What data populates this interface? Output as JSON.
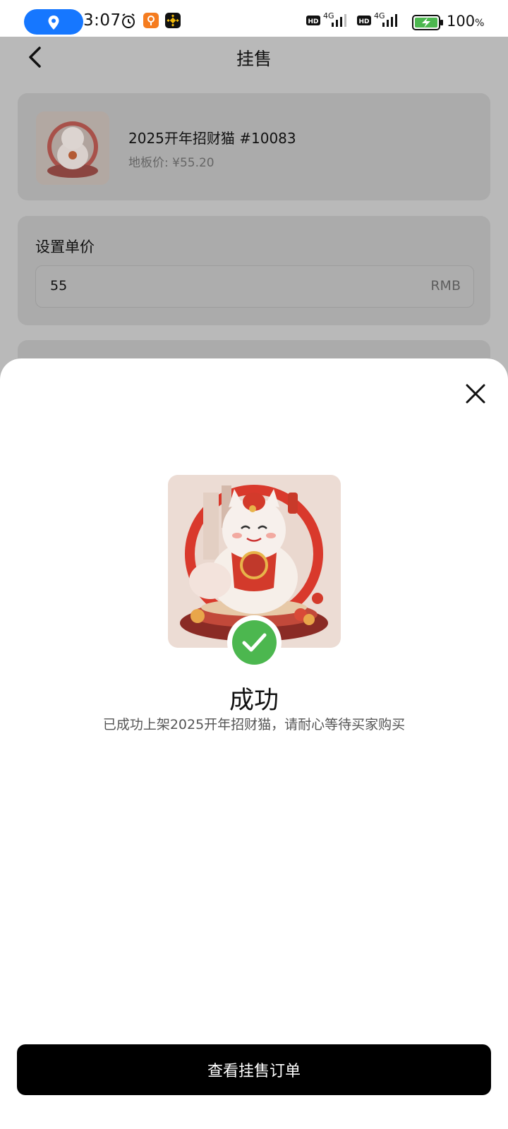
{
  "status_bar": {
    "time": "3:07",
    "battery_percent": "100",
    "battery_unit": "%",
    "network_1": "4G",
    "network_2": "4G",
    "hd_label": "HD",
    "location_pill_color": "#1677ff",
    "icons": [
      "location-icon",
      "alarm-icon",
      "app-notification-icon",
      "binance-icon",
      "signal-icon",
      "battery-charging-icon"
    ]
  },
  "page": {
    "title": "挂售",
    "product": {
      "name": "2025开年招财猫 #10083",
      "floor_price": "地板价: ¥55.20"
    },
    "price_section": {
      "label": "设置单价",
      "value": "55",
      "unit": "RMB"
    }
  },
  "sheet": {
    "title": "成功",
    "description": "已成功上架2025开年招财猫，请耐心等待买家购买",
    "button_label": "查看挂售订单",
    "success_color": "#4cb74f"
  }
}
